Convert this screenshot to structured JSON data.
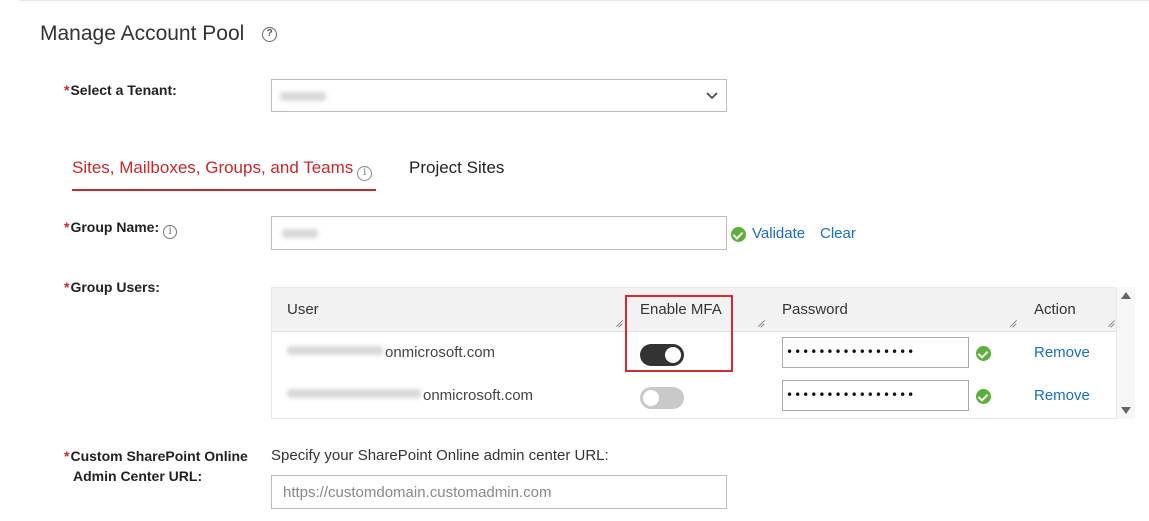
{
  "page": {
    "title": "Manage Account Pool"
  },
  "tenant": {
    "label": "Select a Tenant:",
    "value": ""
  },
  "tabs": [
    {
      "label": "Sites, Mailboxes, Groups, and Teams",
      "active": true
    },
    {
      "label": "Project Sites",
      "active": false
    }
  ],
  "group_name": {
    "label": "Group Name:",
    "value": "",
    "validate_label": "Validate",
    "clear_label": "Clear"
  },
  "group_users": {
    "label": "Group Users:",
    "columns": [
      "User",
      "Enable MFA",
      "Password",
      "Action"
    ],
    "rows": [
      {
        "user_suffix": "onmicrosoft.com",
        "mfa_enabled": true,
        "password": "••••••••••••••••",
        "action": "Remove"
      },
      {
        "user_suffix": "onmicrosoft.com",
        "mfa_enabled": false,
        "password": "••••••••••••••••",
        "action": "Remove"
      }
    ]
  },
  "custom_url": {
    "label_line1": "Custom SharePoint Online",
    "label_line2": "Admin Center URL:",
    "hint": "Specify your SharePoint Online admin center URL:",
    "placeholder": "https://customdomain.customadmin.com"
  },
  "colors": {
    "accent": "#c8262d",
    "link": "#1a6bc4",
    "success": "#5ab03a",
    "highlight": "#d9282f"
  },
  "icons": {
    "help": "help-circle-icon",
    "info": "info-icon",
    "check": "check-circle-icon",
    "chevron": "chevron-down-icon"
  }
}
